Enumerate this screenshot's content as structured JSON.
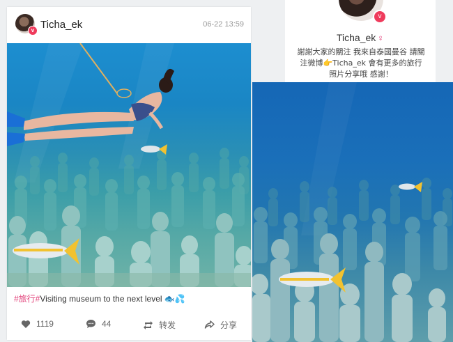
{
  "post": {
    "username": "Ticha_ek",
    "timestamp": "06-22 13:59",
    "caption_tag": "#旅行#",
    "caption_text": "Visiting museum to the next level",
    "caption_emoji": "🐟💦",
    "likes": "1119",
    "comments": "44",
    "repost_label": "转发",
    "share_label": "分享"
  },
  "profile": {
    "name": "Ticha_ek",
    "gender_symbol": "♀",
    "bio_line1": "謝謝大家的關注 我來自泰國曼谷 請關",
    "bio_line2_start": "注微博",
    "bio_line2_pointer": "👉",
    "bio_line2_end": "Ticha_ek 會有更多的旅行",
    "bio_line3": "照片分享哦 感謝！"
  },
  "colors": {
    "accent_pink": "#e2427a",
    "verified_red": "#ef3b5c",
    "water_blue": "#1d8ed0",
    "fish_yellow": "#f2c230"
  },
  "icons": {
    "like": "heart-icon",
    "comment": "comment-icon",
    "repost": "repost-icon",
    "share": "share-icon",
    "verified": "verified-badge-icon"
  }
}
